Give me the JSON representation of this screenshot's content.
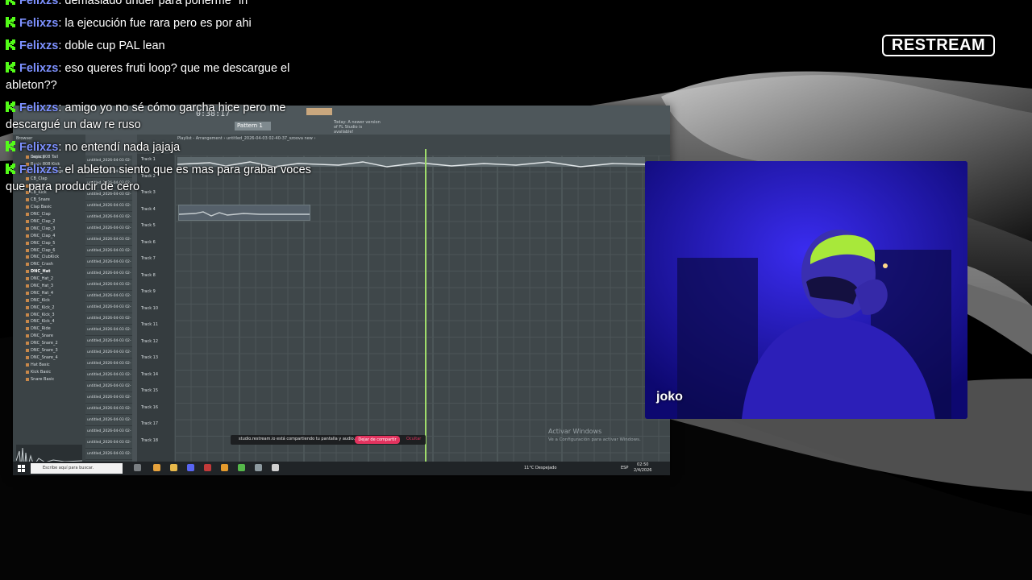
{
  "branding": {
    "restream_logo": "RESTREAM"
  },
  "chat": {
    "messages": [
      {
        "user": "Felixzs",
        "text": "demasiado under para ponerme \"in\""
      },
      {
        "user": "Felixzs",
        "text": "la ejecución fue rara pero es por ahi"
      },
      {
        "user": "Felixzs",
        "text": "doble cup PAL lean"
      },
      {
        "user": "Felixzs",
        "text": "eso queres fruti loop? que me descargue el ableton??"
      },
      {
        "user": "Felixzs",
        "text": "amigo yo no sé cómo garcha hice pero me descargué un daw re ruso"
      },
      {
        "user": "Felixzs",
        "text": "no entendí nada jajaja"
      },
      {
        "user": "Felixzs",
        "text": "el ableton siento que es mas para grabar voces que para producir de cero"
      }
    ]
  },
  "webcam": {
    "name": "joko"
  },
  "screen": {
    "fl": {
      "time": "0:38:17",
      "pattern": "Pattern 1",
      "news": "Today: A newer version of FL Studio is available!",
      "playlist_title": "Playlist - Arrangement › untitled_2026-04-03 02-40-37_szoova new ›",
      "browser_header": "Browser",
      "legacy": "Legacy",
      "browser_items": [
        "Basic 808 Tail",
        "Basic 808 Kick",
        "Basic 808 Snare",
        "CB_Clap",
        "CB_Hat",
        "CB_Kick",
        "CB_Snare",
        "Clap Basic",
        "DNC_Clap",
        "DNC_Clap_2",
        "DNC_Clap_3",
        "DNC_Clap_4",
        "DNC_Clap_5",
        "DNC_Clap_6",
        "DNC_ClubKick",
        "DNC_Crash",
        "DNC_Hat",
        "DNC_Hat_2",
        "DNC_Hat_3",
        "DNC_Hat_4",
        "DNC_Kick",
        "DNC_Kick_2",
        "DNC_Kick_3",
        "DNC_Kick_4",
        "DNC_Ride",
        "DNC_Snare",
        "DNC_Snare_2",
        "DNC_Snare_3",
        "DNC_Snare_4",
        "Hat Basic",
        "Kick Basic",
        "Snare Basic"
      ],
      "active_browser_item": "DNC_Hat",
      "clip_label": "untitled_2026-04-03 02-",
      "tracks": [
        "Track 1",
        "Track 2",
        "Track 3",
        "Track 4",
        "Track 5",
        "Track 6",
        "Track 7",
        "Track 8",
        "Track 9",
        "Track 10",
        "Track 11",
        "Track 12",
        "Track 13",
        "Track 14",
        "Track 15",
        "Track 16",
        "Track 17",
        "Track 18"
      ],
      "thumb_name": "joko"
    },
    "restream_bar": {
      "text": "studio.restream.io está compartiendo tu pantalla y audio.",
      "stop_button": "Dejar de compartir",
      "hide_button": "Ocultar"
    },
    "activate_windows": {
      "title": "Activar Windows",
      "subtitle": "Ve a Configuración para activar Windows."
    },
    "taskbar": {
      "search_placeholder": "Escribe aquí para buscar.",
      "weather": "11°C  Despejado",
      "language": "ESP",
      "time": "02:50",
      "date": "2/4/2026"
    }
  },
  "colors": {
    "chat_username": "#7d91ff",
    "kick_green": "#53fc18",
    "playhead": "#9fdc6b",
    "webcam_blue": "#1a0fa8",
    "stop_share_red": "#e3335f"
  }
}
